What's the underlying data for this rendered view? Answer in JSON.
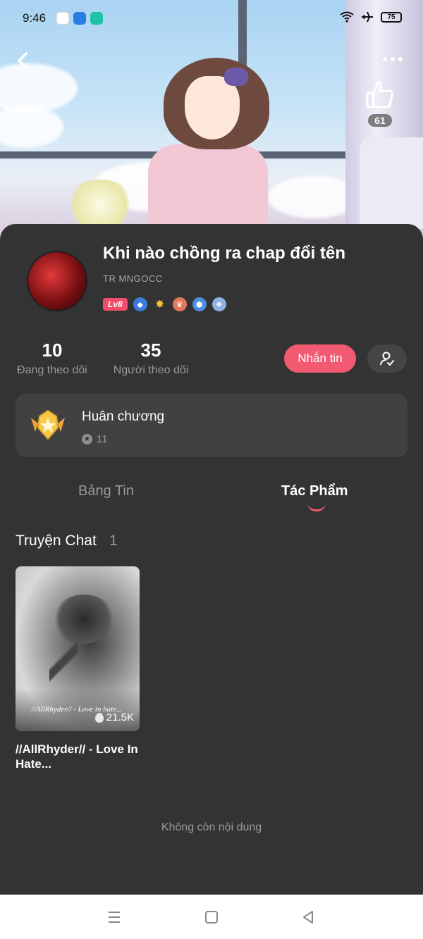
{
  "status_bar": {
    "time": "9:46",
    "battery": "75",
    "apps": [
      "tiktok-icon",
      "app-blue-icon",
      "app-teal-icon"
    ]
  },
  "header": {
    "like_count": "61"
  },
  "profile": {
    "name": "Khi nào chồng ra chap đổi tên",
    "user_id": "TR MNGOCC",
    "level": "Lv8"
  },
  "stats": {
    "following_count": "10",
    "following_label": "Đang theo dõi",
    "followers_count": "35",
    "followers_label": "Người theo dõi"
  },
  "actions": {
    "message_label": "Nhắn tin"
  },
  "medals": {
    "title": "Huân chương",
    "count": "11"
  },
  "tabs": {
    "news": "Bảng Tin",
    "works": "Tác Phẩm"
  },
  "section": {
    "title": "Truyện Chat",
    "count": "1"
  },
  "stories": [
    {
      "cover_text": "//AllRhyder// - Love in hate...",
      "views": "21.5K",
      "title": "//AllRhyder// - Love In Hate..."
    }
  ],
  "end_message": "Không còn nội dung",
  "colors": {
    "accent": "#f25a72",
    "background": "#333333",
    "card": "#414141"
  }
}
